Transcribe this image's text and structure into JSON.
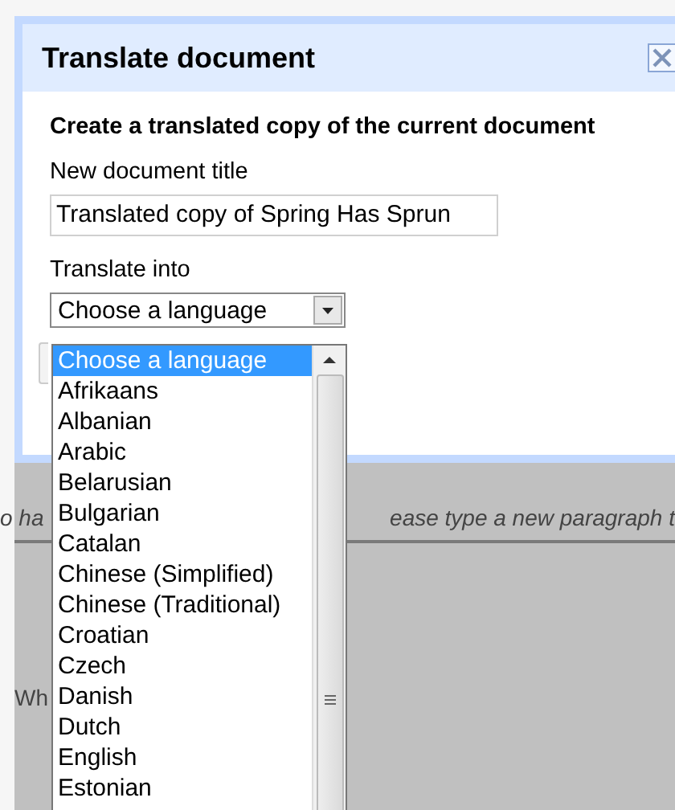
{
  "dialog": {
    "title": "Translate document",
    "heading": "Create a translated copy of the current document",
    "title_label": "New document title",
    "title_value": "Translated copy of Spring Has Sprun",
    "language_label": "Translate into",
    "language_select": {
      "value": "Choose a language",
      "expanded": true,
      "options": [
        {
          "label": "Choose a language",
          "selected": true
        },
        {
          "label": "Afrikaans",
          "selected": false
        },
        {
          "label": "Albanian",
          "selected": false
        },
        {
          "label": "Arabic",
          "selected": false
        },
        {
          "label": "Belarusian",
          "selected": false
        },
        {
          "label": "Bulgarian",
          "selected": false
        },
        {
          "label": "Catalan",
          "selected": false
        },
        {
          "label": "Chinese (Simplified)",
          "selected": false
        },
        {
          "label": "Chinese (Traditional)",
          "selected": false
        },
        {
          "label": "Croatian",
          "selected": false
        },
        {
          "label": "Czech",
          "selected": false
        },
        {
          "label": "Danish",
          "selected": false
        },
        {
          "label": "Dutch",
          "selected": false
        },
        {
          "label": "English",
          "selected": false
        },
        {
          "label": "Estonian",
          "selected": false
        }
      ]
    }
  },
  "document": {
    "line_1_left": "o ha",
    "line_1_right": "ease type a new paragraph t",
    "line_2": "Wh"
  }
}
